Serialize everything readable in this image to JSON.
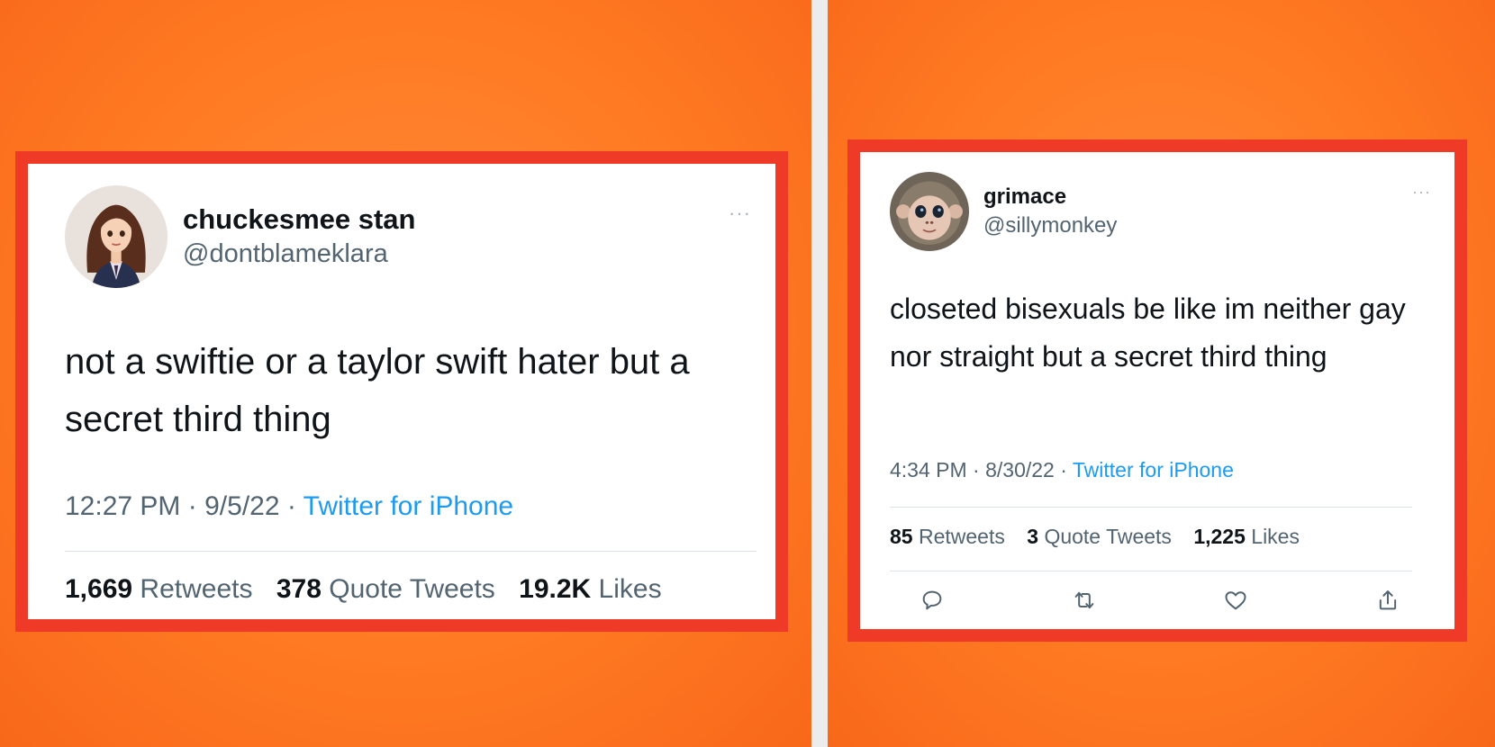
{
  "tweets": [
    {
      "display_name": "chuckesmee stan",
      "handle": "@dontblameklara",
      "more": "···",
      "text": "not a swiftie or a taylor swift hater but a secret third thing",
      "time": "12:27 PM",
      "date": "9/5/22",
      "separator": "·",
      "source": "Twitter for iPhone",
      "retweets": {
        "count": "1,669",
        "label": "Retweets"
      },
      "quotes": {
        "count": "378",
        "label": "Quote Tweets"
      },
      "likes": {
        "count": "19.2K",
        "label": "Likes"
      },
      "avatar_icon": "cartoon-woman-avatar-icon"
    },
    {
      "display_name": "grimace",
      "handle": "@sillymonkey",
      "more": "···",
      "text": "closeted bisexuals be like im neither gay nor straight but a secret third thing",
      "time": "4:34 PM",
      "date": "8/30/22",
      "separator": "·",
      "source": "Twitter for iPhone",
      "retweets": {
        "count": "85",
        "label": "Retweets"
      },
      "quotes": {
        "count": "3",
        "label": "Quote Tweets"
      },
      "likes": {
        "count": "1,225",
        "label": "Likes"
      },
      "avatar_icon": "monkey-avatar-icon",
      "action_icons": [
        "reply-icon",
        "retweet-icon",
        "like-icon",
        "share-icon"
      ]
    }
  ],
  "colors": {
    "background": "#ff7a22",
    "frame_border": "#ee3a27",
    "link": "#1d9bf0",
    "secondary_text": "#536471",
    "primary_text": "#0f1419"
  }
}
